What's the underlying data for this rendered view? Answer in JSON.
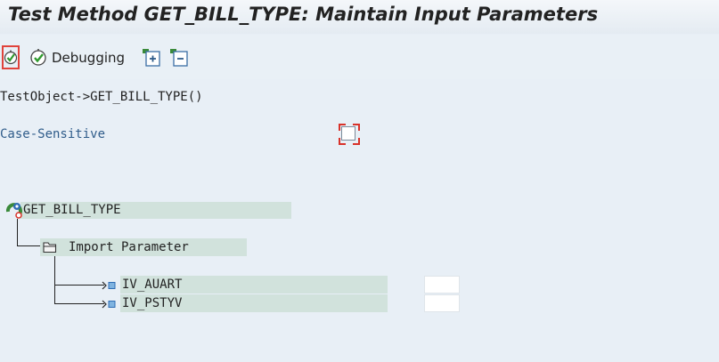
{
  "window": {
    "title": "Test Method GET_BILL_TYPE: Maintain Input Parameters"
  },
  "toolbar": {
    "execute_icon": "execute-icon",
    "debugging_label": "Debugging",
    "expand_icon": "expand-all-icon",
    "collapse_icon": "collapse-all-icon"
  },
  "main": {
    "test_object": "TestObject->GET_BILL_TYPE()",
    "case_sensitive_label": "Case-Sensitive",
    "case_sensitive_checked": false
  },
  "tree": {
    "root": {
      "label": "GET_BILL_TYPE",
      "icon": "method-icon"
    },
    "folder": {
      "label": "Import Parameter",
      "icon": "folder-icon"
    },
    "params": [
      {
        "name": "IV_AUART",
        "value": ""
      },
      {
        "name": "IV_PSTYV",
        "value": ""
      }
    ]
  },
  "colors": {
    "background": "#e8eff6",
    "node_highlight": "#d1e2dc",
    "accent_red": "#e0443c",
    "label_blue": "#2f5c8a"
  }
}
